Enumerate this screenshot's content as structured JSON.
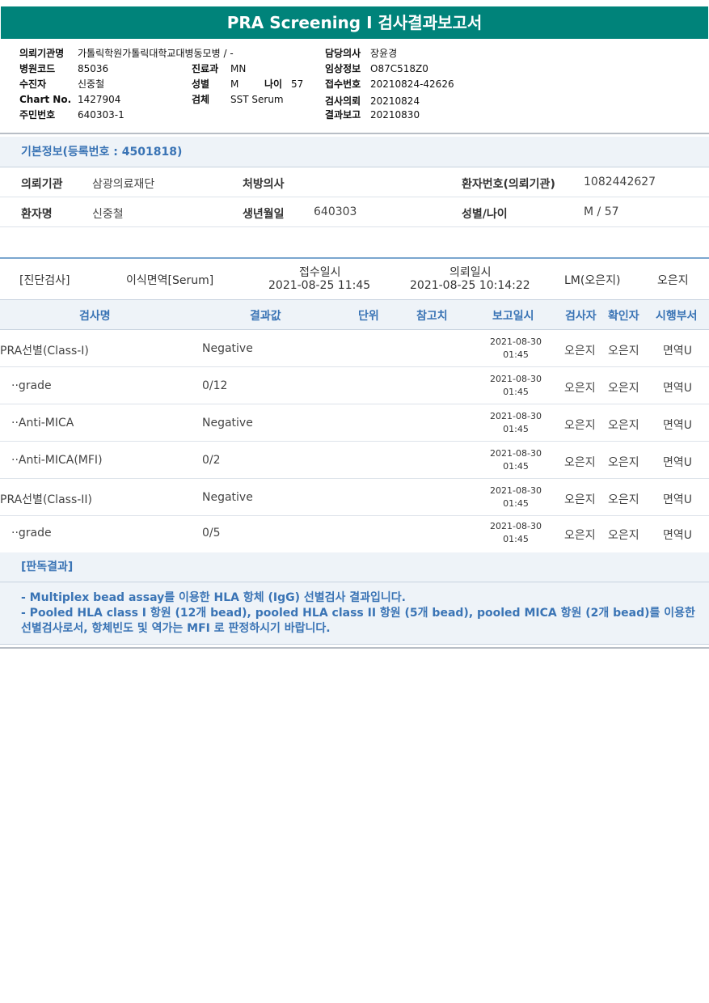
{
  "title": "PRA Screening I 검사결과보고서",
  "header": {
    "institution_label": "의뢰기관명",
    "institution": "가톨릭학원가톨릭대학교대병동모병 / -",
    "hospital_code_label": "병원코드",
    "hospital_code": "85036",
    "receiver_label": "수진자",
    "receiver": "신중철",
    "chart_label": "Chart No.",
    "chart": "1427904",
    "resident_label": "주민번호",
    "resident": "640303-1",
    "dept_label": "진료과",
    "dept": "MN",
    "sex_label": "성별",
    "sex": "M",
    "age_label": "나이",
    "age": "57",
    "specimen_label": "검체",
    "specimen": "SST Serum",
    "doctor_label": "담당의사",
    "doctor": "장윤경",
    "clinical_label": "임상정보",
    "clinical": "O87C518Z0",
    "receipt_label": "접수번호",
    "receipt": "20210824-42626",
    "request_label": "검사의뢰",
    "request": "20210824",
    "report_label": "결과보고",
    "report": "20210830"
  },
  "basic": {
    "title": "기본정보(등록번호 : 4501818)",
    "req_org_label": "의뢰기관",
    "req_org": "삼광의료재단",
    "prescriber_label": "처방의사",
    "prescriber": "",
    "patient_no_label": "환자번호(의뢰기관)",
    "patient_no": "1082442627",
    "patient_name_label": "환자명",
    "patient_name": "신중철",
    "birth_label": "생년월일",
    "birth": "640303",
    "sex_age_label": "성별/나이",
    "sex_age": "M / 57"
  },
  "diagnosis": {
    "category": "[진단검사]",
    "test": "이식면역[Serum]",
    "received_label": "접수일시",
    "received": "2021-08-25  11:45",
    "requested_label": "의뢰일시",
    "requested": "2021-08-25  10:14:22",
    "lab": "LM(오은지)",
    "person": "오은지"
  },
  "table": {
    "headers": [
      "검사명",
      "결과값",
      "단위",
      "참고치",
      "보고일시",
      "검사자",
      "확인자",
      "시행부서"
    ],
    "rows": [
      {
        "name": "PRA선별(Class-I)",
        "result": "Negative",
        "unit": "",
        "ref": "",
        "date": "2021-08-30",
        "time": "01:45",
        "tester": "오은지",
        "checker": "오은지",
        "dept": "면역U"
      },
      {
        "name": "··grade",
        "result": "0/12",
        "unit": "",
        "ref": "",
        "date": "2021-08-30",
        "time": "01:45",
        "tester": "오은지",
        "checker": "오은지",
        "dept": "면역U"
      },
      {
        "name": "··Anti-MICA",
        "result": "Negative",
        "unit": "",
        "ref": "",
        "date": "2021-08-30",
        "time": "01:45",
        "tester": "오은지",
        "checker": "오은지",
        "dept": "면역U"
      },
      {
        "name": "··Anti-MICA(MFI)",
        "result": "0/2",
        "unit": "",
        "ref": "",
        "date": "2021-08-30",
        "time": "01:45",
        "tester": "오은지",
        "checker": "오은지",
        "dept": "면역U"
      },
      {
        "name": "PRA선별(Class-II)",
        "result": "Negative",
        "unit": "",
        "ref": "",
        "date": "2021-08-30",
        "time": "01:45",
        "tester": "오은지",
        "checker": "오은지",
        "dept": "면역U"
      },
      {
        "name": "··grade",
        "result": "0/5",
        "unit": "",
        "ref": "",
        "date": "2021-08-30",
        "time": "01:45",
        "tester": "오은지",
        "checker": "오은지",
        "dept": "면역U"
      }
    ]
  },
  "interpretation": {
    "title": "[판독결과]",
    "line1": "- Multiplex bead assay를 이용한 HLA 항체 (IgG) 선별검사 결과입니다.",
    "line2": "- Pooled HLA class I 항원 (12개 bead), pooled HLA class II 항원 (5개 bead), pooled MICA 항원 (2개 bead)를 이용한 선별검사로서, 항체빈도 및 역가는 MFI 로 판정하시기 바랍니다."
  },
  "colors": {
    "title_bg": "#00837a",
    "accent": "#3a74b5",
    "section_bg": "#eef3f8"
  }
}
